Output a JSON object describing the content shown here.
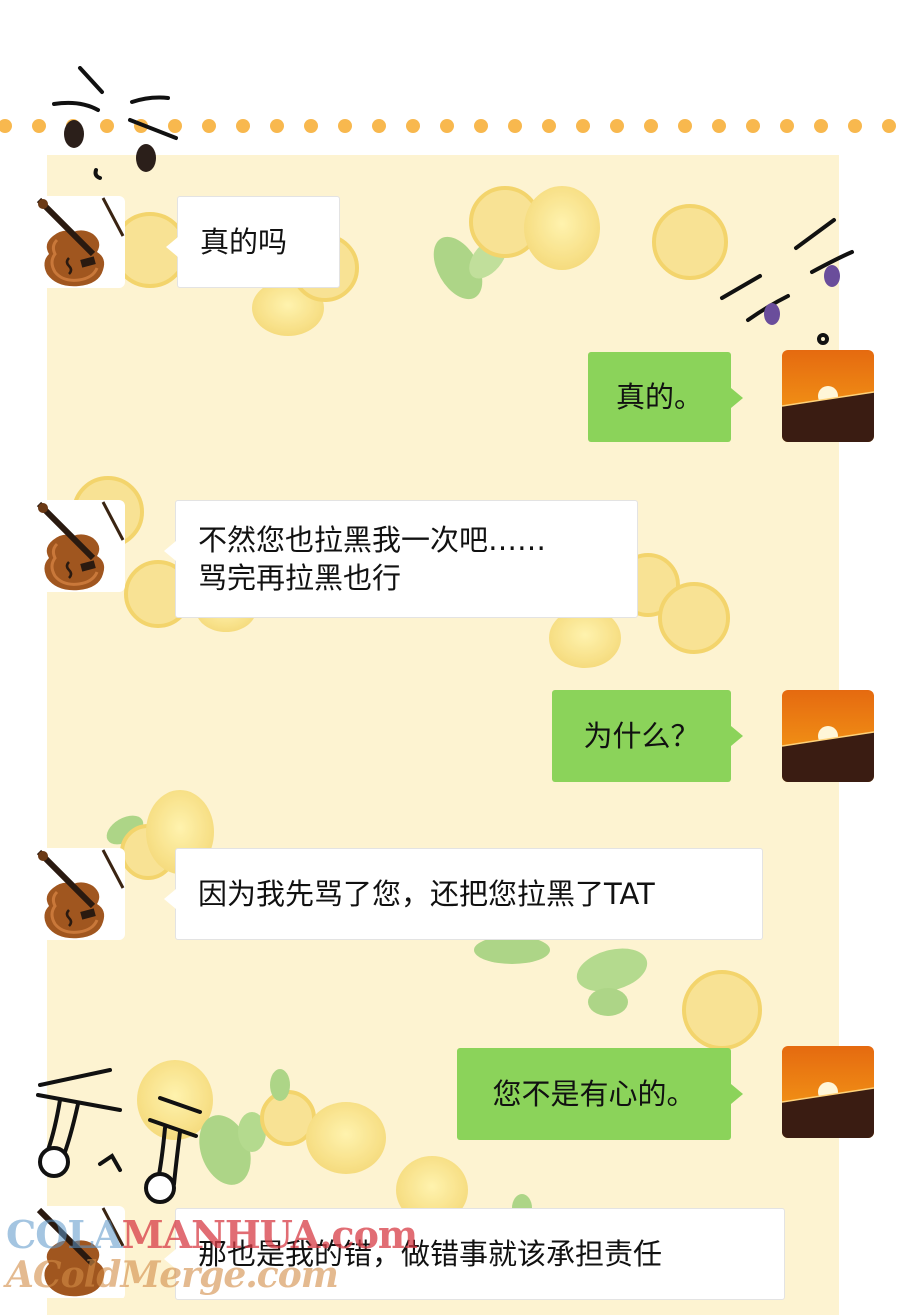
{
  "theme": {
    "panel_bg": "#fdf3d1",
    "dot_color": "#f8b84e",
    "bubble_left_bg": "#ffffff",
    "bubble_right_bg": "#8bd35a"
  },
  "avatars": {
    "left": "violin-avatar",
    "right": "sunset-avatar"
  },
  "messages": [
    {
      "side": "left",
      "text": "真的吗"
    },
    {
      "side": "right",
      "text": "真的。"
    },
    {
      "side": "left",
      "text": "不然您也拉黑我一次吧……\n骂完再拉黑也行"
    },
    {
      "side": "right",
      "text": "为什么？"
    },
    {
      "side": "left",
      "text": "因为我先骂了您，还把您拉黑了TAT"
    },
    {
      "side": "right",
      "text": "您不是有心的。"
    },
    {
      "side": "left",
      "text": "那也是我的错，做错事就该承担责任"
    }
  ],
  "watermark": {
    "line1_prefix": "COLA",
    "line1_main": "MANHUA.com",
    "line2": "AColdMerge.com"
  }
}
